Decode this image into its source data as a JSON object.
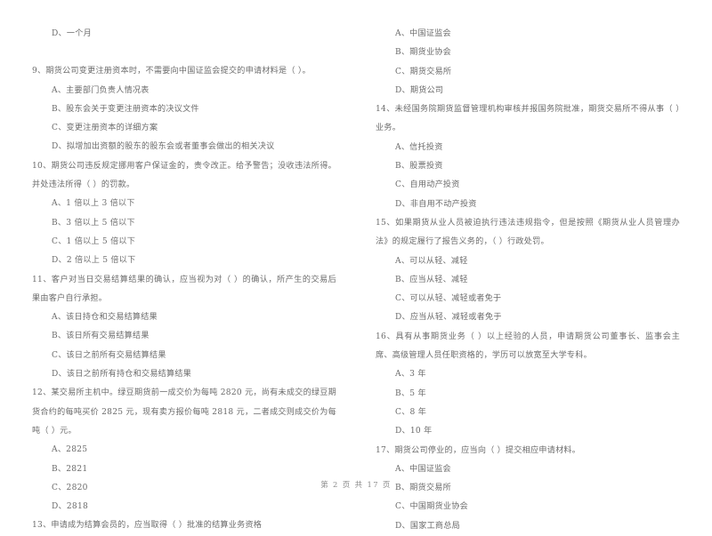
{
  "document": {
    "page_footer": "第 2 页  共 17 页",
    "page_number": "2",
    "total_pages": "17",
    "text_color": "#6b6b6b",
    "background_color": "#ffffff"
  },
  "left_column": {
    "orphan_option": "D、一个月",
    "questions": [
      {
        "stem": "9、期货公司变更注册资本时，不需要向中国证监会提交的申请材料是（        ）。",
        "options": [
          "A、主要部门负责人情况表",
          "B、股东会关于变更注册资本的决议文件",
          "C、变更注册资本的详细方案",
          "D、拟增加出资额的股东的股东会或者董事会做出的相关决议"
        ]
      },
      {
        "stem": "10、期货公司违反规定挪用客户保证金的，责令改正。给予警告；没收违法所得。并处违法所得（        ）的罚款。",
        "options": [
          "A、1 倍以上 3 倍以下",
          "B、3 倍以上 5 倍以下",
          "C、1 倍以上 5 倍以下",
          "D、2 倍以上 5 倍以下"
        ]
      },
      {
        "stem": "11、客户对当日交易结算结果的确认，应当视为对（        ）的确认，所产生的交易后果由客户自行承担。",
        "options": [
          "A、该日持仓和交易结算结果",
          "B、该日所有交易结算结果",
          "C、该日之前所有交易结算结果",
          "D、该日之前所有持仓和交易结算结果"
        ]
      },
      {
        "stem": "12、某交易所主机中。绿豆期货前一成交价为每吨 2820 元，尚有未成交的绿豆期货合约的每吨买价 2825 元，现有卖方报价每吨 2818 元，二者成交则成交价为每吨（        ）元。",
        "options": [
          "A、2825",
          "B、2821",
          "C、2820",
          "D、2818"
        ]
      },
      {
        "stem": "13、申请成为结算会员的，应当取得（        ）批准的结算业务资格",
        "options": []
      }
    ]
  },
  "right_column": {
    "orphan_options": [
      "A、中国证监会",
      "B、期货业协会",
      "C、期货交易所",
      "D、期货公司"
    ],
    "questions": [
      {
        "stem": "14、未经国务院期货监督管理机构审核并报国务院批准，期货交易所不得从事（        ）业务。",
        "options": [
          "A、信托投资",
          "B、股票投资",
          "C、自用动产投资",
          "D、非自用不动产投资"
        ]
      },
      {
        "stem": "15、如果期货从业人员被迫执行违法违规指令，但是按照《期货从业人员管理办法》的规定履行了报告义务的，（        ）行政处罚。",
        "options": [
          "A、可以从轻、减轻",
          "B、应当从轻、减轻",
          "C、可以从轻、减轻或者免于",
          "D、应当从轻、减轻或者免于"
        ]
      },
      {
        "stem": "16、具有从事期货业务（        ）以上经验的人员，申请期货公司董事长、监事会主席、高级管理人员任职资格的，学历可以放宽至大学专科。",
        "options": [
          "A、3 年",
          "B、5 年",
          "C、8 年",
          "D、10 年"
        ]
      },
      {
        "stem": "17、期货公司停业的，应当向（        ）提交相应申请材料。",
        "options": [
          "A、中国证监会",
          "B、期货交易所",
          "C、中国期货业协会",
          "D、国家工商总局"
        ]
      }
    ]
  }
}
